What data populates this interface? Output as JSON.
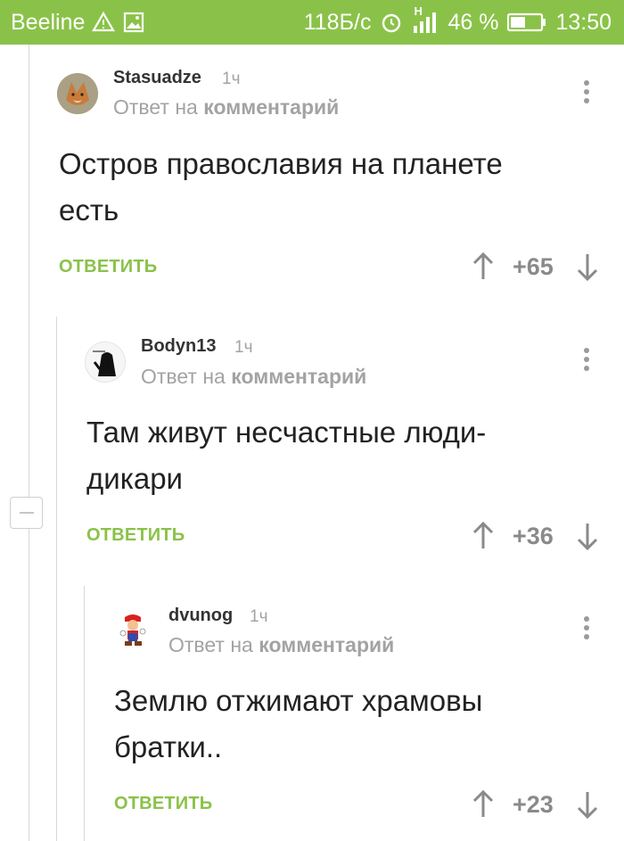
{
  "status_bar": {
    "carrier": "Beeline",
    "speed": "118Б/с",
    "network_label": "H",
    "battery": "46 %",
    "time": "13:50",
    "background": "#8ac249"
  },
  "comments": [
    {
      "author": "Stasuadze",
      "time": "1ч",
      "reply_prefix": "Ответ на",
      "reply_target": "комментарий",
      "text": "Остров православия на планете есть",
      "reply_label": "ОТВЕТИТЬ",
      "rating": "+65",
      "avatar_icon": "fox-avatar"
    },
    {
      "author": "Bodyn13",
      "time": "1ч",
      "reply_prefix": "Ответ на",
      "reply_target": "комментарий",
      "text": "Там живут несчастные люди-дикари",
      "reply_label": "ОТВЕТИТЬ",
      "rating": "+36",
      "avatar_icon": "dark-figure-avatar"
    },
    {
      "author": "dvunog",
      "time": "1ч",
      "reply_prefix": "Ответ на",
      "reply_target": "комментарий",
      "text": "Землю отжимают храмовы братки..",
      "reply_label": "ОТВЕТИТЬ",
      "rating": "+23",
      "avatar_icon": "mario-avatar"
    }
  ],
  "colors": {
    "accent": "#8ac249",
    "muted": "#a3a3a3",
    "rating": "#8a8a8a"
  }
}
